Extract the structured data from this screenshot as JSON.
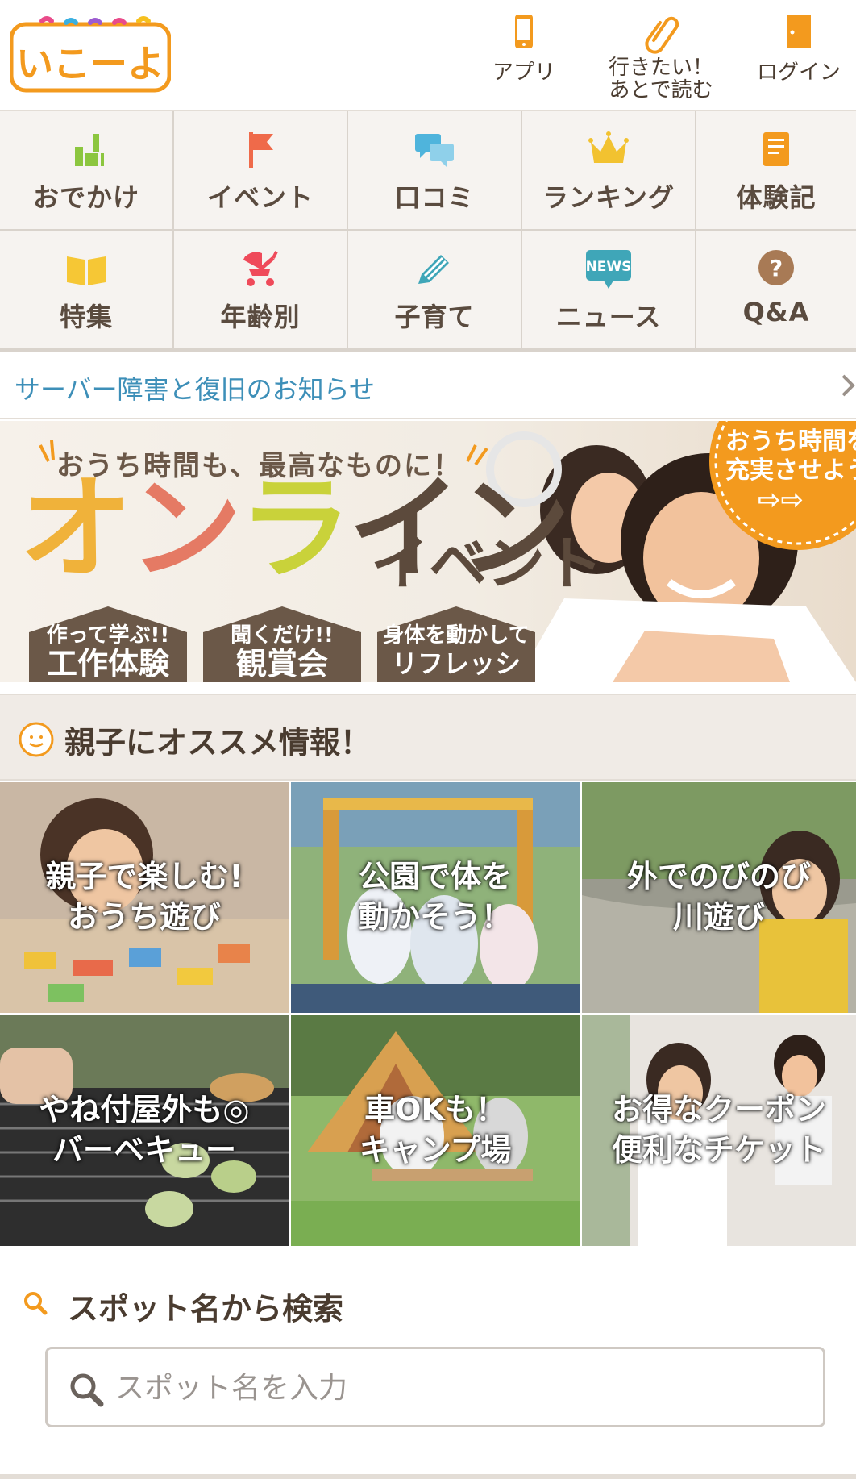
{
  "header": {
    "logo_text": "いこーよ",
    "app_label": "アプリ",
    "later_line1": "行きたい！",
    "later_line2": "あとで読む",
    "login_label": "ログイン"
  },
  "categories": [
    {
      "label": "おでかけ",
      "icon": "outing-icon"
    },
    {
      "label": "イベント",
      "icon": "flag-icon"
    },
    {
      "label": "口コミ",
      "icon": "chat-bubbles-icon"
    },
    {
      "label": "ランキング",
      "icon": "crown-icon"
    },
    {
      "label": "体験記",
      "icon": "notebook-icon"
    },
    {
      "label": "特集",
      "icon": "open-book-icon"
    },
    {
      "label": "年齢別",
      "icon": "stroller-icon"
    },
    {
      "label": "子育て",
      "icon": "pencil-icon"
    },
    {
      "label": "ニュース",
      "icon": "news-icon"
    },
    {
      "label": "Q&A",
      "icon": "question-icon"
    }
  ],
  "news_badge": "NEWS",
  "notice": {
    "text": "サーバー障害と復旧のお知らせ"
  },
  "banner": {
    "tagline": "おうち時間も、最高なものに！",
    "headline_1": "オ",
    "headline_2": "ン",
    "headline_3": "ラ",
    "headline_4": "イン",
    "headline_sub": "イベント",
    "houses": [
      {
        "small": "作って学ぶ!!",
        "large": "工作体験"
      },
      {
        "small": "聞くだけ!!",
        "large": "観賞会"
      },
      {
        "small": "身体を動かして",
        "large": "リフレッシュ!"
      }
    ],
    "badge_line1": "おうち時間を",
    "badge_line2": "充実させよう",
    "badge_arrows": "⇨⇨"
  },
  "recommend": {
    "title": "親子にオススメ情報！",
    "tiles": [
      {
        "line1": "親子で楽しむ!",
        "line2": "おうち遊び"
      },
      {
        "line1": "公園で体を",
        "line2": "動かそう！"
      },
      {
        "line1": "外でのびのび",
        "line2": "川遊び"
      },
      {
        "line1": "やね付屋外も◎",
        "line2": "バーベキュー"
      },
      {
        "line1": "車OKも！",
        "line2": "キャンプ場"
      },
      {
        "line1": "お得なクーポン",
        "line2": "便利なチケット"
      }
    ]
  },
  "search": {
    "title": "スポット名から検索",
    "placeholder": "スポット名を入力"
  },
  "colors": {
    "brand_orange": "#f39a1e",
    "notice_blue": "#3d8fb8",
    "text_brown": "#4a3c30",
    "grid_bg": "#f6f3f0"
  }
}
